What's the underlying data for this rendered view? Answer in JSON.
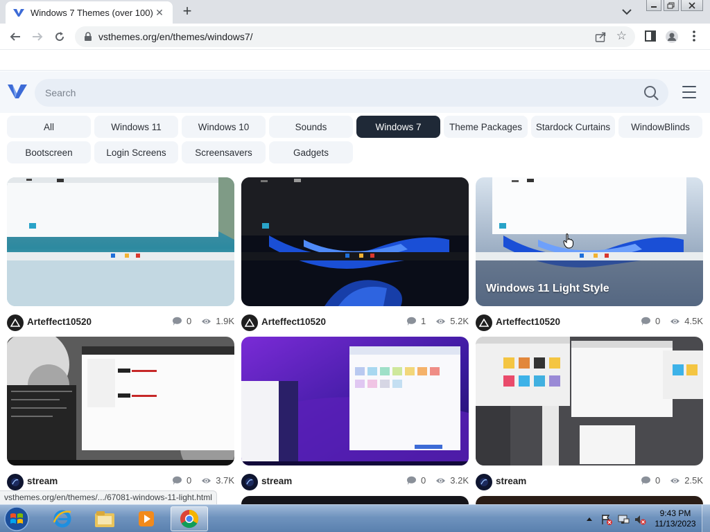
{
  "browser": {
    "tab_title": "Windows 7 Themes (over 100)",
    "url": "vsthemes.org/en/themes/windows7/",
    "status_url": "vsthemes.org/en/themes/.../67081-windows-11-light.html"
  },
  "site": {
    "search_placeholder": "Search",
    "categories": [
      {
        "label": "All"
      },
      {
        "label": "Windows 11"
      },
      {
        "label": "Windows 10"
      },
      {
        "label": "Sounds"
      },
      {
        "label": "Windows 7"
      },
      {
        "label": "Theme Packages"
      },
      {
        "label": "Stardock Curtains"
      },
      {
        "label": "WindowBlinds"
      },
      {
        "label": "Bootscreen"
      },
      {
        "label": "Login Screens"
      },
      {
        "label": "Screensavers"
      },
      {
        "label": "Gadgets"
      }
    ],
    "active_category": "Windows 7"
  },
  "cards": [
    {
      "author": "Arteffect10520",
      "comments": "0",
      "views": "1.9K",
      "title": ""
    },
    {
      "author": "Arteffect10520",
      "comments": "1",
      "views": "5.2K",
      "title": ""
    },
    {
      "author": "Arteffect10520",
      "comments": "0",
      "views": "4.5K",
      "title": "Windows 11 Light Style"
    },
    {
      "author": "stream",
      "comments": "0",
      "views": "3.7K",
      "title": ""
    },
    {
      "author": "stream",
      "comments": "0",
      "views": "3.2K",
      "title": ""
    },
    {
      "author": "stream",
      "comments": "0",
      "views": "2.5K",
      "title": ""
    }
  ],
  "taskbar": {
    "time": "9:43 PM",
    "date": "11/13/2023"
  },
  "colors": {
    "active_category_bg": "#1f2937",
    "site_accent": "#3d6bd6"
  }
}
